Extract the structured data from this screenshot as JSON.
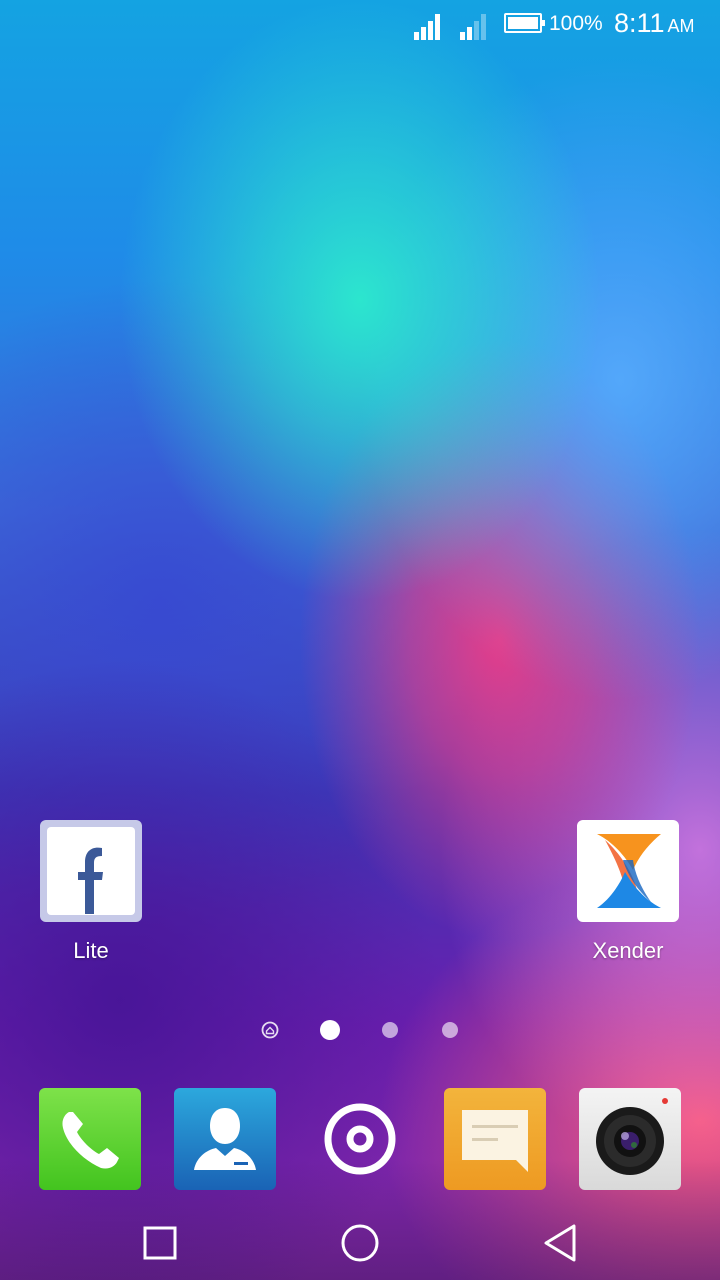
{
  "status_bar": {
    "battery_percent": "100%",
    "time": "8:11",
    "ampm": "AM",
    "signal_1_icon": "signal-strong-icon",
    "signal_2_icon": "signal-weak-icon",
    "battery_icon": "battery-full-icon"
  },
  "home": {
    "apps": [
      {
        "label": "Lite",
        "icon": "facebook-lite-icon"
      },
      {
        "label": "Xender",
        "icon": "xender-icon"
      }
    ],
    "page_indicator": {
      "pages": 4,
      "current": 2,
      "home_page_icon": "home-page-icon"
    }
  },
  "dock": {
    "items": [
      {
        "icon": "phone-icon"
      },
      {
        "icon": "contacts-icon"
      },
      {
        "icon": "app-launcher-icon"
      },
      {
        "icon": "messages-icon"
      },
      {
        "icon": "camera-icon"
      }
    ]
  },
  "nav_bar": {
    "recents_icon": "recents-icon",
    "home_icon": "home-icon",
    "back_icon": "back-icon"
  },
  "colors": {
    "facebook_blue": "#3b5998",
    "xender_orange": "#f7931e",
    "xender_blue": "#1e88e5",
    "status_text": "#ffffff"
  }
}
